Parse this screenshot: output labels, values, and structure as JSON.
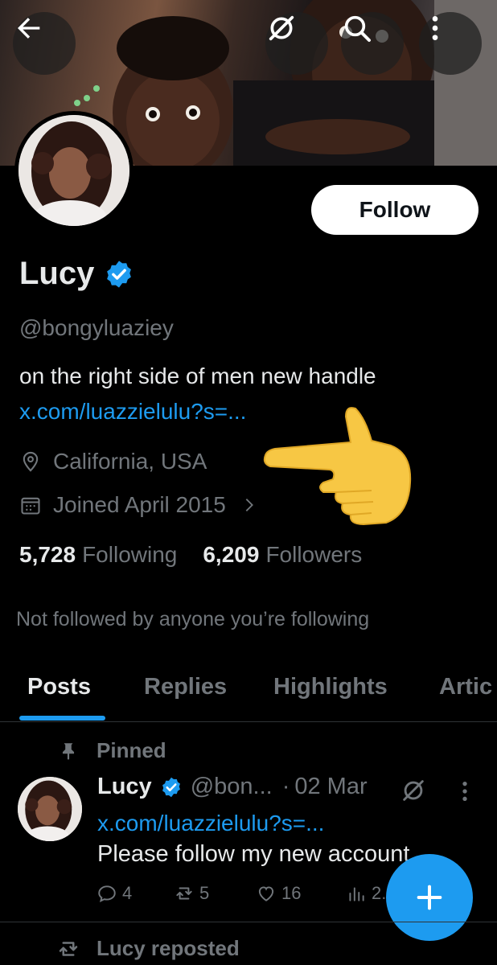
{
  "header": {
    "back_icon": "arrow-left-icon",
    "grok_icon": "grok-icon",
    "search_icon": "search-icon",
    "more_icon": "more-vertical-icon"
  },
  "profile": {
    "follow_label": "Follow",
    "name": "Lucy",
    "handle": "@bongyluaziey",
    "bio": "on the right side of men new handle",
    "link": "x.com/luazzielulu?s=...",
    "location": "California, USA",
    "joined": "Joined April 2015",
    "following_count": "5,728",
    "following_label": "Following",
    "followers_count": "6,209",
    "followers_label": "Followers",
    "not_followed": "Not followed by anyone you’re following"
  },
  "tabs": [
    {
      "label": "Posts",
      "active": true
    },
    {
      "label": "Replies",
      "active": false
    },
    {
      "label": "Highlights",
      "active": false
    },
    {
      "label": "Artic",
      "active": false
    }
  ],
  "pinned_post": {
    "pinned_label": "Pinned",
    "author_name": "Lucy",
    "author_handle": "@bon...",
    "dot": "·",
    "date": "02 Mar",
    "link": "x.com/luazzielulu?s=...",
    "text": "Please follow my new account",
    "replies": "4",
    "reposts": "5",
    "likes": "16",
    "views": "2.7"
  },
  "next_item": {
    "repost_label": "Lucy reposted"
  },
  "colors": {
    "accent": "#1d9bf0",
    "background": "#000000",
    "text_primary": "#e7e9ea",
    "text_secondary": "#71767b"
  }
}
